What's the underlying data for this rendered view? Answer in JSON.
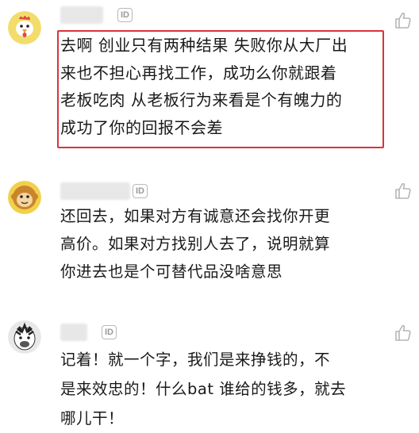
{
  "comments": [
    {
      "avatar_icon": "rooster-avatar-icon",
      "badge": "ID",
      "like_icon": "thumbs-up-icon",
      "text": "去啊 创业只有两种结果 失败你从大厂出\n来也不担心再找工作，成功么你就跟着\n老板吃肉 从老板行为来看是个有魄力的\n成功了你的回报不会差",
      "highlighted": true,
      "highlight_color": "#d9343a"
    },
    {
      "avatar_icon": "monkey-avatar-icon",
      "badge": "ID",
      "like_icon": "thumbs-up-icon",
      "text": "还回去，如果对方有诚意还会找你开更\n高价。如果对方找别人去了，说明就算\n你进去也是个可替代品没啥意思"
    },
    {
      "avatar_icon": "zebra-avatar-icon",
      "badge": "ID",
      "like_icon": "thumbs-up-icon",
      "text": "记着！就一个字，我们是来挣钱的，不\n是来效忠的！什么bat 谁给的钱多，就去\n哪儿干！"
    }
  ]
}
